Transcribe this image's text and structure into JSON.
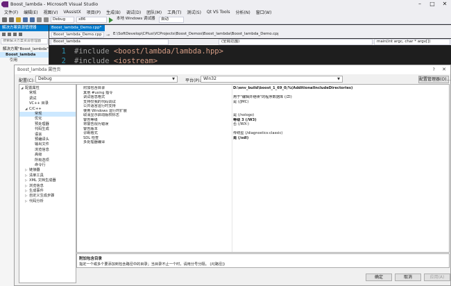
{
  "window": {
    "title": "Boost_lambda - Microsoft Visual Studio",
    "controls": [
      "–",
      "□",
      "✕"
    ]
  },
  "menu": [
    "文件(F)",
    "编辑(E)",
    "视图(V)",
    "VAssistX",
    "项目(P)",
    "生成(B)",
    "调试(D)",
    "团队(M)",
    "工具(T)",
    "测试(S)",
    "Qt VS Tools",
    "分析(N)",
    "窗口(W)"
  ],
  "toolbar": {
    "configuration": "Debug",
    "platform": "x86",
    "debugger": "本地 Windows 调试器",
    "auto": "自动"
  },
  "solution_explorer": {
    "header": "解决方案资源管理器",
    "search_placeholder": "搜索解决方案资源管理器",
    "items": [
      "解决方案\"Boost_lambda\"",
      "Boost_lambda",
      "引用"
    ]
  },
  "editor": {
    "tab": "Boost_lambda_Demo.cpp*",
    "path_file": "Boost_lambda_Demo.cpp",
    "path": "E:\\SoftDevelop\\CPlus\\VCProjects\\Boost_Demos\\Boost_lambda\\Boost_lambda_Demo.cpp",
    "nav_project": "Boost_lambda",
    "nav_scope": "(全局范围)",
    "nav_function": "main(int argc, char * argv[])",
    "lines": [
      {
        "num": "1",
        "keyword": "#include",
        "header": "<boost/lambda/lambda.hpp>"
      },
      {
        "num": "2",
        "keyword": "#include",
        "header": "<iostream>"
      }
    ]
  },
  "dialog": {
    "title": "Boost_lambda 属性页",
    "help": "?",
    "close": "✕",
    "config_label": "配置(C):",
    "config_value": "Debug",
    "platform_label": "平台(P):",
    "platform_value": "Win32",
    "config_manager": "配置管理器(O)...",
    "tree": [
      {
        "label": "配置属性",
        "toggle": "◢",
        "level": 0
      },
      {
        "label": "常规",
        "level": 1
      },
      {
        "label": "调试",
        "level": 1
      },
      {
        "label": "VC++ 目录",
        "level": 1
      },
      {
        "label": "C/C++",
        "toggle": "◢",
        "level": 1
      },
      {
        "label": "常规",
        "level": 2,
        "selected": true
      },
      {
        "label": "优化",
        "level": 2
      },
      {
        "label": "预处理器",
        "level": 2
      },
      {
        "label": "代码生成",
        "level": 2
      },
      {
        "label": "语言",
        "level": 2
      },
      {
        "label": "预编译头",
        "level": 2
      },
      {
        "label": "输出文件",
        "level": 2
      },
      {
        "label": "浏览信息",
        "level": 2
      },
      {
        "label": "高级",
        "level": 2
      },
      {
        "label": "所有选项",
        "level": 2
      },
      {
        "label": "命令行",
        "level": 2
      },
      {
        "label": "链接器",
        "toggle": "▷",
        "level": 1
      },
      {
        "label": "清单工具",
        "toggle": "▷",
        "level": 1
      },
      {
        "label": "XML 文档生成器",
        "toggle": "▷",
        "level": 1
      },
      {
        "label": "浏览信息",
        "toggle": "▷",
        "level": 1
      },
      {
        "label": "生成事件",
        "toggle": "▷",
        "level": 1
      },
      {
        "label": "自定义生成步骤",
        "toggle": "▷",
        "level": 1
      },
      {
        "label": "代码分析",
        "toggle": "▷",
        "level": 1
      }
    ],
    "properties": [
      {
        "name": "附加包含目录",
        "value": "D:\\env_build\\boost_1_69_0;%(AdditionalIncludeDirectories)",
        "bold": true
      },
      {
        "name": "其他 #using 指令",
        "value": ""
      },
      {
        "name": "调试信息格式",
        "value": "用于\"编辑并继续\"的程序数据库 (/ZI)"
      },
      {
        "name": "支持仅我的代码调试",
        "value": "是 (/JMC)"
      },
      {
        "name": "公共语言运行时支持",
        "value": ""
      },
      {
        "name": "使用 Windows 运行时扩展",
        "value": ""
      },
      {
        "name": "取消显示启动版权标志",
        "value": "是 (/nologo)"
      },
      {
        "name": "警告等级",
        "value": "等级 3 (/W3)",
        "bold": true
      },
      {
        "name": "将警告视为错误",
        "value": "否 (/WX-)"
      },
      {
        "name": "警告版本",
        "value": ""
      },
      {
        "name": "诊断格式",
        "value": "传统型 (/diagnostics:classic)"
      },
      {
        "name": "SDL 检查",
        "value": "是 (/sdl)",
        "bold": true
      },
      {
        "name": "多处理器编译",
        "value": ""
      }
    ],
    "description": {
      "title": "附加包含目录",
      "text": "指定一个或多个要添加到包含路径中的目录；当目录不止一个时，请用分号分隔。     (/I[路径])"
    },
    "buttons": {
      "ok": "确定",
      "cancel": "取消",
      "apply": "应用(A)"
    }
  },
  "colors": {
    "accent": "#007acc",
    "chrome": "#eeeef2",
    "editor_bg": "#1e1e1e",
    "selection": "#cce8ff"
  }
}
